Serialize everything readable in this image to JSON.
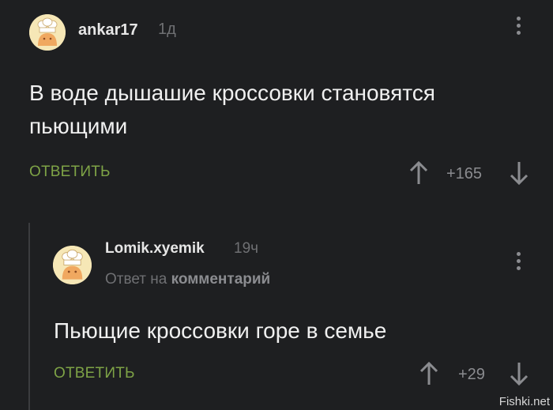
{
  "comment": {
    "username": "ankar17",
    "time": "1д",
    "text": "В воде дышашие кроссовки становятся пьющими",
    "reply_label": "ОТВЕТИТЬ",
    "score": "+165"
  },
  "reply": {
    "username": "Lomik.xyemik",
    "time": "19ч",
    "context_prefix": "Ответ на",
    "context_link": "комментарий",
    "text": "Пьющие кроссовки горе в семье",
    "reply_label": "ОТВЕТИТЬ",
    "score": "+29"
  },
  "watermark": "Fishki.net",
  "colors": {
    "background": "#1e1f21",
    "reply_accent": "#7ea346",
    "muted": "#8b8c90",
    "avatar_bg": "#f6e7b6"
  },
  "icons": {
    "upvote": "arrow-up-icon",
    "downvote": "arrow-down-icon",
    "menu": "kebab-menu-icon"
  }
}
